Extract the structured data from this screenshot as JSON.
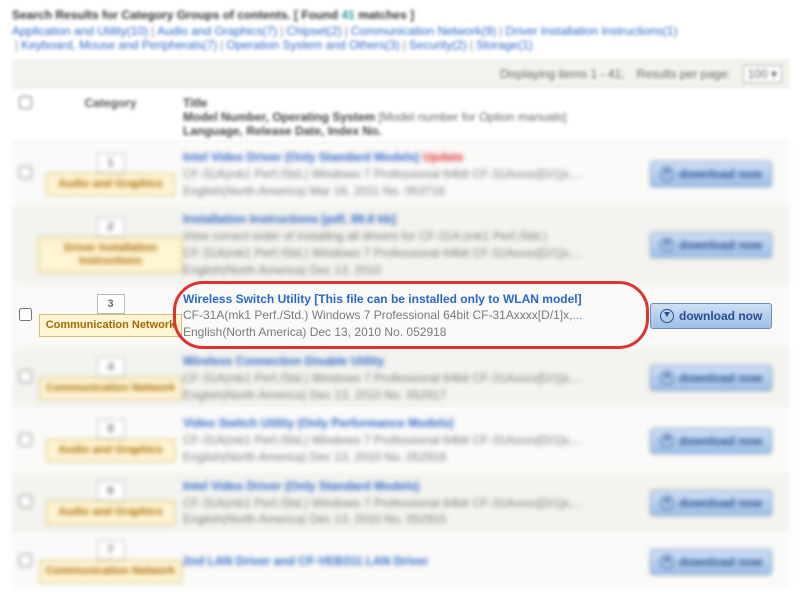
{
  "search": {
    "label_prefix": "Search Results for Category Groups of contents.   [ Found ",
    "match_count": "41",
    "label_suffix": " matches ]"
  },
  "filters": [
    "Application and Utility(10)",
    "Audio and Graphics(7)",
    "Chipset(2)",
    "Communication Network(9)",
    "Driver Installation Instructions(1)",
    "Keyboard, Mouse and Peripherals(7)",
    "Operation System and Others(3)",
    "Security(2)",
    "Storage(1)"
  ],
  "toolbar": {
    "displaying": "Displaying items 1 - 41;",
    "rpp_label": "Results per page:",
    "rpp_value": "100"
  },
  "thead": {
    "category": "Category",
    "line1": "Title",
    "line2a": "Model Number, Operating System ",
    "line2b": "[Model number for Option manuals]",
    "line3": "Language, Release Date, Index No."
  },
  "dl_label": "download now",
  "rows": [
    {
      "n": "1",
      "cat": "Audio and Graphics",
      "title": "Intel Video Driver (Only Standard Models)",
      "flag": "Update",
      "l2": "CF-31A(mk1 Perf./Std.) Windows 7 Professional 64bit   CF-31Axxxx[D/1]x,...",
      "l3": "English(North America)   Mar 16, 2011   No. 053716",
      "check": true
    },
    {
      "n": "2",
      "cat": "Driver Installation Instructions",
      "title": "Installation Instructions [pdf, 89.8 kb]",
      "flag": "",
      "l2": "View correct order of installing all drivers for CF-31A (mk1 Perf./Std.)",
      "l3": "CF-31A(mk1 Perf./Std.) Windows 7 Professional 64bit   CF-31Axxxx[D/1]x,...\nEnglish(North America)   Dec 13, 2010",
      "check": false
    },
    {
      "n": "3",
      "cat": "Communication Network",
      "title": "Wireless Switch Utility [This file can be installed only to WLAN model]",
      "flag": "",
      "l2": "CF-31A(mk1 Perf./Std.) Windows 7 Professional 64bit   CF-31Axxxx[D/1]x,...",
      "l3": "English(North America)   Dec 13, 2010   No. 052918",
      "check": true
    },
    {
      "n": "4",
      "cat": "Communication Network",
      "title": "Wireless Connection Disable Utility",
      "flag": "",
      "l2": "CF-31A(mk1 Perf./Std.) Windows 7 Professional 64bit   CF-31Axxxx[D/1]x,...",
      "l3": "English(North America)   Dec 13, 2010   No. 052917",
      "check": true
    },
    {
      "n": "5",
      "cat": "Audio and Graphics",
      "title": "Video Switch Utility (Only Performance Models)",
      "flag": "",
      "l2": "CF-31A(mk1 Perf./Std.) Windows 7 Professional 64bit   CF-31Axxxx[D/1]x,...",
      "l3": "English(North America)   Dec 13, 2010   No. 052916",
      "check": true
    },
    {
      "n": "6",
      "cat": "Audio and Graphics",
      "title": "Intel Video Driver (Only Standard Models)",
      "flag": "",
      "l2": "CF-31A(mk1 Perf./Std.) Windows 7 Professional 64bit   CF-31Axxxx[D/1]x,...",
      "l3": "English(North America)   Dec 13, 2010   No. 052915",
      "check": true
    },
    {
      "n": "7",
      "cat": "Communication Network",
      "title": "2nd LAN Driver and CF-VEB311 LAN Driver",
      "flag": "",
      "l2": "",
      "l3": "",
      "check": true
    }
  ],
  "highlight_index": 2
}
